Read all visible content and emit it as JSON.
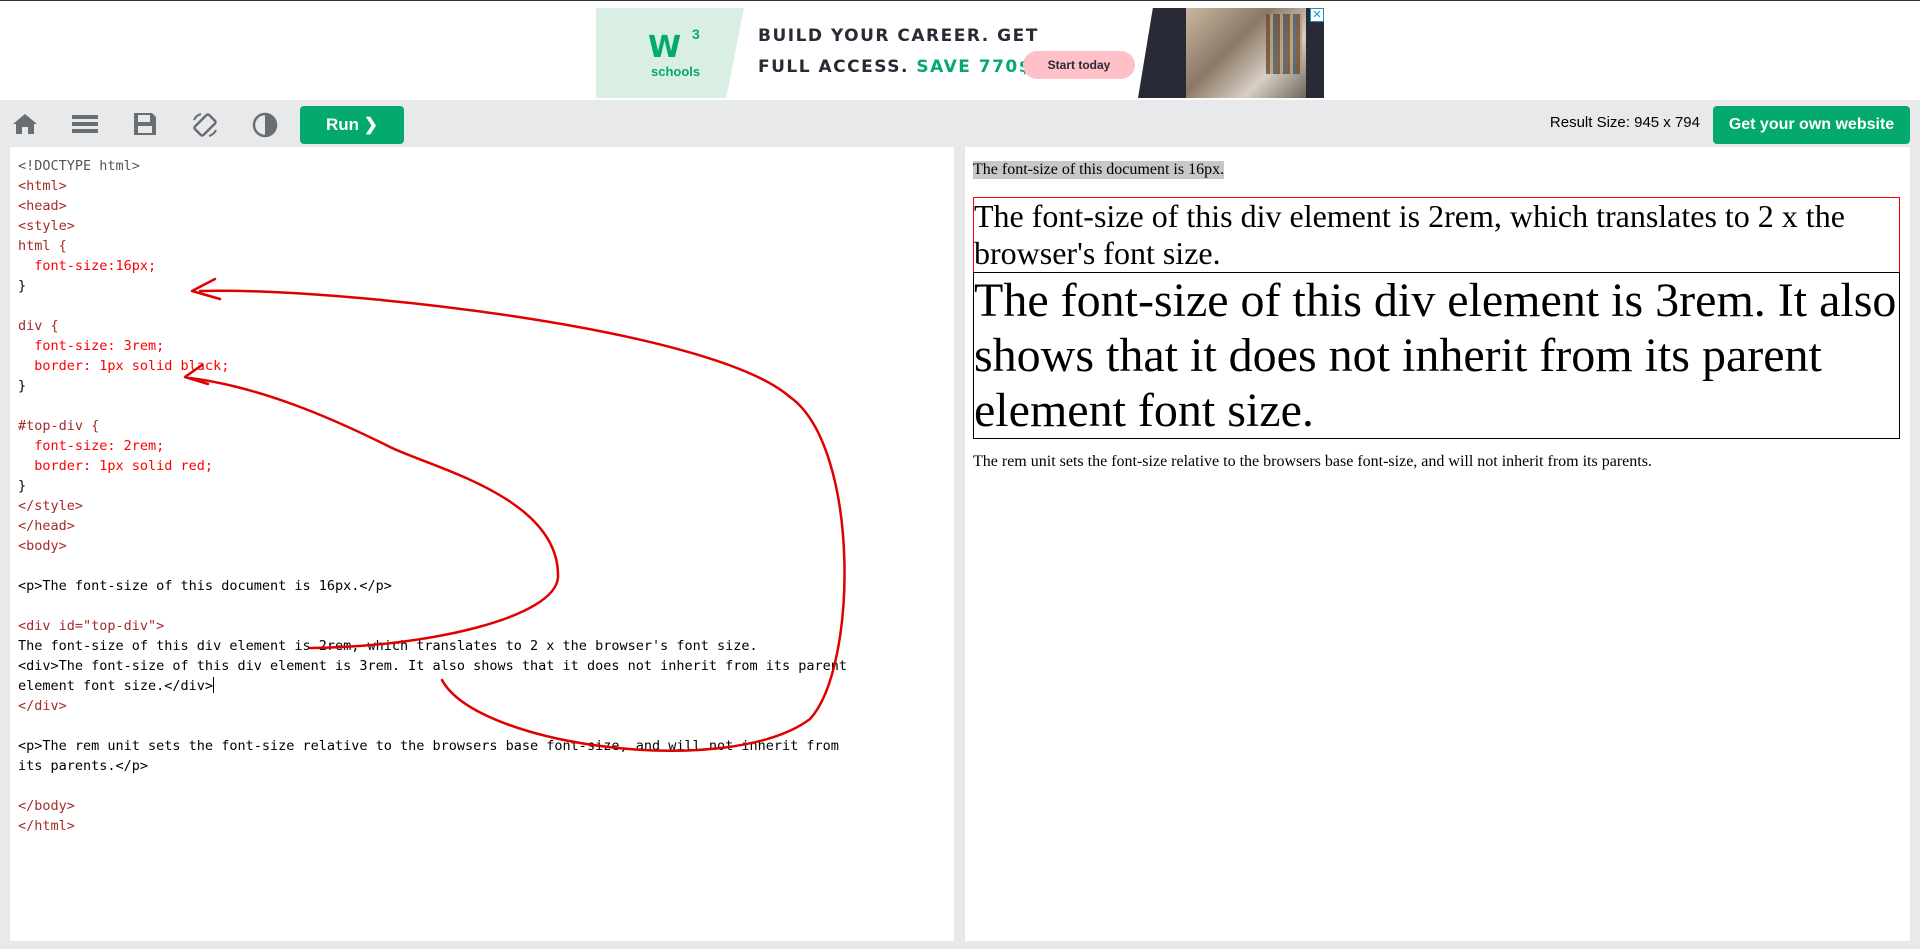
{
  "ad": {
    "logo_main": "W",
    "logo_sup": "3",
    "logo_sub": "schools",
    "headline1": "BUILD YOUR CAREER. GET",
    "headline2": "FULL ACCESS.",
    "save_text": "SAVE 770$",
    "button": "Start today",
    "close": "✕"
  },
  "toolbar": {
    "icons": [
      "home-icon",
      "menu-icon",
      "save-icon",
      "rotate-icon",
      "contrast-icon"
    ],
    "run_label": "Run ❯",
    "result_size": "Result Size: 945 x 794",
    "own_site_label": "Get your own website"
  },
  "editor": {
    "code_lines": [
      "<!DOCTYPE html>",
      "<html>",
      "<head>",
      "<style>",
      "html {",
      "  font-size:16px;",
      "}",
      "",
      "div {",
      "  font-size: 3rem;",
      "  border: 1px solid black;",
      "}",
      "",
      "#top-div {",
      "  font-size: 2rem;",
      "  border: 1px solid red;",
      "}",
      "</style>",
      "</head>",
      "<body>",
      "",
      "<p>The font-size of this document is 16px.</p>",
      "",
      "<div id=\"top-div\">",
      "The font-size of this div element is 2rem, which translates to 2 x the browser's font size.",
      "<div>The font-size of this div element is 3rem. It also shows that it does not inherit from its parent",
      "element font size.</div>",
      "</div>",
      "",
      "<p>The rem unit sets the font-size relative to the browsers base font-size, and will not inherit from",
      "its parents.</p>",
      "",
      "</body>",
      "</html>"
    ]
  },
  "result": {
    "p1": "The font-size of this document is 16px.",
    "top_div": "The font-size of this div element is 2rem, which translates to 2 x the browser's font size.",
    "inner_div": "The font-size of this div element is 3rem. It also shows that it does not inherit from its parent element font size.",
    "p2": "The rem unit sets the font-size relative to the browsers base font-size, and will not inherit from its parents."
  },
  "colors": {
    "brand_green": "#04aa6d",
    "annotation_red": "#e00000",
    "toolbar_bg": "#e7e9eb"
  }
}
